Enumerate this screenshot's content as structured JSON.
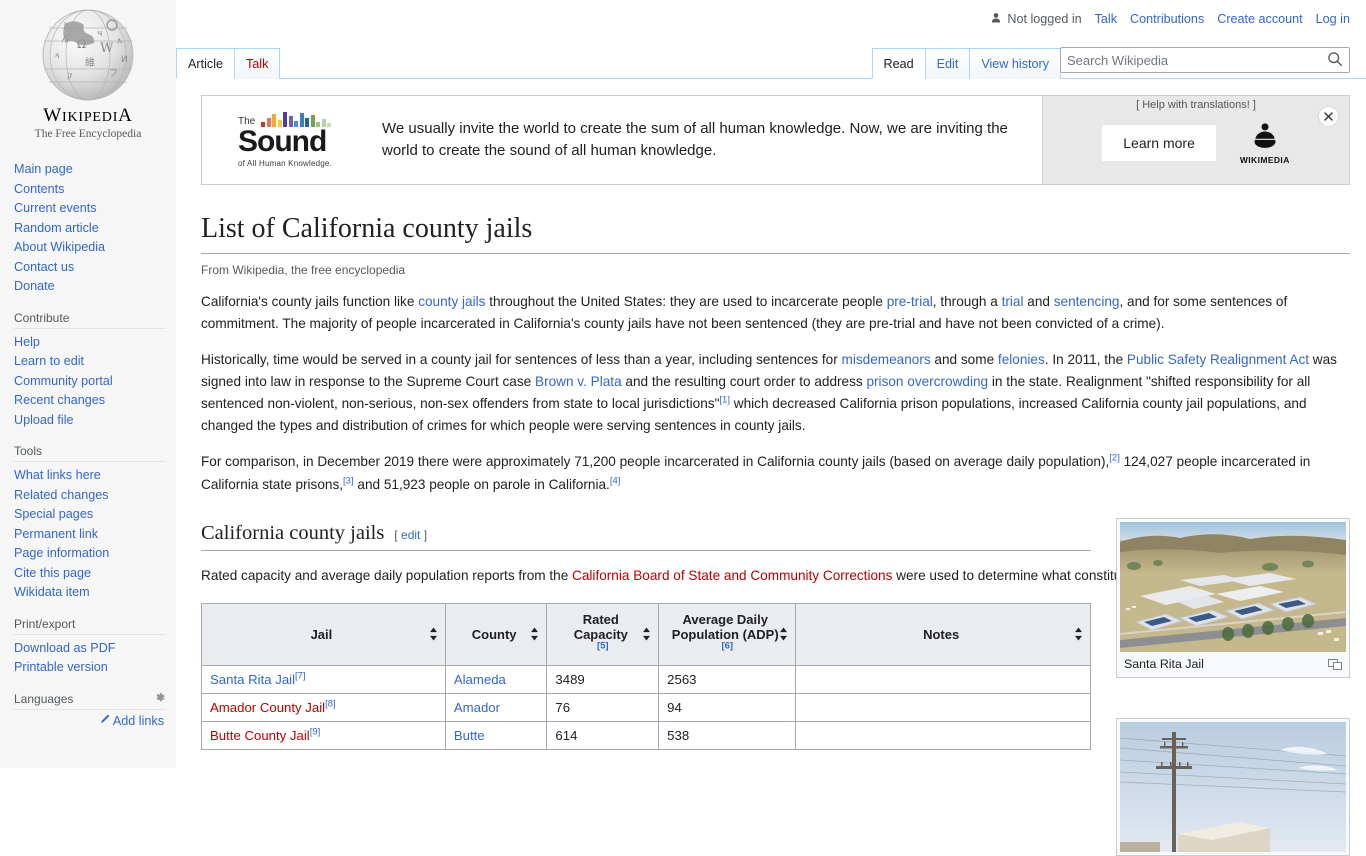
{
  "site": {
    "wordmark_big": "W",
    "wordmark": "IKIPEDI",
    "wordmark_end": "A",
    "tagline": "The Free Encyclopedia"
  },
  "user_bar": {
    "not_logged_in": "Not logged in",
    "links": [
      {
        "label": "Talk"
      },
      {
        "label": "Contributions"
      },
      {
        "label": "Create account"
      },
      {
        "label": "Log in"
      }
    ]
  },
  "tabs": {
    "namespaces": [
      {
        "label": "Article",
        "selected": true,
        "new": false
      },
      {
        "label": "Talk",
        "selected": false,
        "new": true
      }
    ],
    "views": [
      {
        "label": "Read",
        "selected": true
      },
      {
        "label": "Edit",
        "selected": false
      },
      {
        "label": "View history",
        "selected": false
      }
    ]
  },
  "search": {
    "placeholder": "Search Wikipedia",
    "value": "",
    "icon": "search-icon"
  },
  "sidebar": {
    "navigation": [
      {
        "label": "Main page"
      },
      {
        "label": "Contents"
      },
      {
        "label": "Current events"
      },
      {
        "label": "Random article"
      },
      {
        "label": "About Wikipedia"
      },
      {
        "label": "Contact us"
      },
      {
        "label": "Donate"
      }
    ],
    "contribute_heading": "Contribute",
    "contribute": [
      {
        "label": "Help"
      },
      {
        "label": "Learn to edit"
      },
      {
        "label": "Community portal"
      },
      {
        "label": "Recent changes"
      },
      {
        "label": "Upload file"
      }
    ],
    "tools_heading": "Tools",
    "tools": [
      {
        "label": "What links here"
      },
      {
        "label": "Related changes"
      },
      {
        "label": "Special pages"
      },
      {
        "label": "Permanent link"
      },
      {
        "label": "Page information"
      },
      {
        "label": "Cite this page"
      },
      {
        "label": "Wikidata item"
      }
    ],
    "print_heading": "Print/export",
    "print": [
      {
        "label": "Download as PDF"
      },
      {
        "label": "Printable version"
      }
    ],
    "languages_heading": "Languages",
    "add_links": "Add links"
  },
  "banner": {
    "logo": {
      "the": "The",
      "word": "Sound",
      "sub": "of All Human Knowledge.",
      "bar_colors": [
        "#c0392b",
        "#e8745c",
        "#f0a830",
        "#f5c842",
        "#4a3f9f",
        "#6f5fc0",
        "#4a90d9",
        "#3b7fbf",
        "#2e5f8a",
        "#6aa84f",
        "#9fc47c",
        "#b8cfa0",
        "#c9d6b8"
      ]
    },
    "message": "We usually invite the world to create the sum of all human knowledge. Now, we are inviting the world to create the sound of all human knowledge.",
    "help_translations": "[ Help with translations! ]",
    "help_translations_link": "Help with translations!",
    "learn_more": "Learn more",
    "wikimedia_label": "WIKIMEDIA",
    "close_label": "×"
  },
  "article": {
    "title": "List of California county jails",
    "site_sub": "From Wikipedia, the free encyclopedia",
    "paragraph1": {
      "parts": [
        {
          "t": "California's county jails function like ",
          "k": "text"
        },
        {
          "t": "county jails",
          "k": "link"
        },
        {
          "t": " throughout the United States: they are used to incarcerate people ",
          "k": "text"
        },
        {
          "t": "pre-trial",
          "k": "link"
        },
        {
          "t": ", through a ",
          "k": "text"
        },
        {
          "t": "trial",
          "k": "link"
        },
        {
          "t": " and ",
          "k": "text"
        },
        {
          "t": "sentencing",
          "k": "link"
        },
        {
          "t": ", and for some sentences of commitment. The majority of people incarcerated in California's county jails have not been sentenced (they are pre-trial and have not been convicted of a crime).",
          "k": "text"
        }
      ]
    },
    "paragraph2": {
      "parts": [
        {
          "t": "Historically, time would be served in a county jail for sentences of less than a year, including sentences for ",
          "k": "text"
        },
        {
          "t": "misdemeanors",
          "k": "link"
        },
        {
          "t": " and some ",
          "k": "text"
        },
        {
          "t": "felonies",
          "k": "link"
        },
        {
          "t": ". In 2011, the ",
          "k": "text"
        },
        {
          "t": "Public Safety Realignment Act",
          "k": "link"
        },
        {
          "t": " was signed into law in response to the Supreme Court case ",
          "k": "text"
        },
        {
          "t": "Brown v. Plata",
          "k": "link"
        },
        {
          "t": " and the resulting court order to address ",
          "k": "text"
        },
        {
          "t": "prison overcrowding",
          "k": "link"
        },
        {
          "t": " in the state. Realignment \"shifted responsibility for all sentenced non-violent, non-serious, non-sex offenders from state to local jurisdictions\"",
          "k": "text"
        },
        {
          "t": "[1]",
          "k": "ref"
        },
        {
          "t": " which decreased California prison populations, increased California county jail populations, and changed the types and distribution of crimes for which people were serving sentences in county jails.",
          "k": "text"
        }
      ]
    },
    "paragraph3": {
      "parts": [
        {
          "t": "For comparison, in December 2019 there were approximately 71,200 people incarcerated in California county jails (based on average daily population),",
          "k": "text"
        },
        {
          "t": "[2]",
          "k": "ref"
        },
        {
          "t": " 124,027 people incarcerated in California state prisons,",
          "k": "text"
        },
        {
          "t": "[3]",
          "k": "ref"
        },
        {
          "t": " and 51,923 people on parole in California.",
          "k": "text"
        },
        {
          "t": "[4]",
          "k": "ref"
        }
      ]
    },
    "section_heading": "California county jails",
    "section_edit_open": "[",
    "section_edit": "edit",
    "section_edit_close": "]",
    "section_note": {
      "parts": [
        {
          "t": "Rated capacity and average daily population reports from the ",
          "k": "text"
        },
        {
          "t": "California Board of State and Community Corrections",
          "k": "newlink"
        },
        {
          "t": " were used to determine what constitutes a distinct jail facility for this list.",
          "k": "text"
        }
      ]
    }
  },
  "table": {
    "columns": [
      {
        "label": "Jail",
        "sortable": true,
        "ref": ""
      },
      {
        "label": "County",
        "sortable": true,
        "ref": ""
      },
      {
        "label": "Rated Capacity",
        "sortable": true,
        "ref": "[5]"
      },
      {
        "label": "Average Daily Population (ADP)",
        "sortable": true,
        "ref": "[6]"
      },
      {
        "label": "Notes",
        "sortable": true,
        "ref": ""
      }
    ],
    "rows": [
      {
        "jail": "Santa Rita Jail",
        "jail_ref": "[7]",
        "jail_new": false,
        "county": "Alameda",
        "rated_capacity": "3489",
        "adp": "2563",
        "notes": ""
      },
      {
        "jail": "Amador County Jail",
        "jail_ref": "[8]",
        "jail_new": true,
        "county": "Amador",
        "rated_capacity": "76",
        "adp": "94",
        "notes": ""
      },
      {
        "jail": "Butte County Jail",
        "jail_ref": "[9]",
        "jail_new": true,
        "county": "Butte",
        "rated_capacity": "614",
        "adp": "538",
        "notes": ""
      }
    ]
  },
  "thumbnails": [
    {
      "caption": "Santa Rita Jail",
      "alt": "Aerial photograph of Santa Rita Jail complex with solar-panelled roofs surrounded by dry golden hills",
      "magnify": "magnify-icon"
    },
    {
      "caption": "",
      "alt": "Photograph of a utility pole and wires against a pale blue sky above a building",
      "magnify": "magnify-icon"
    }
  ]
}
